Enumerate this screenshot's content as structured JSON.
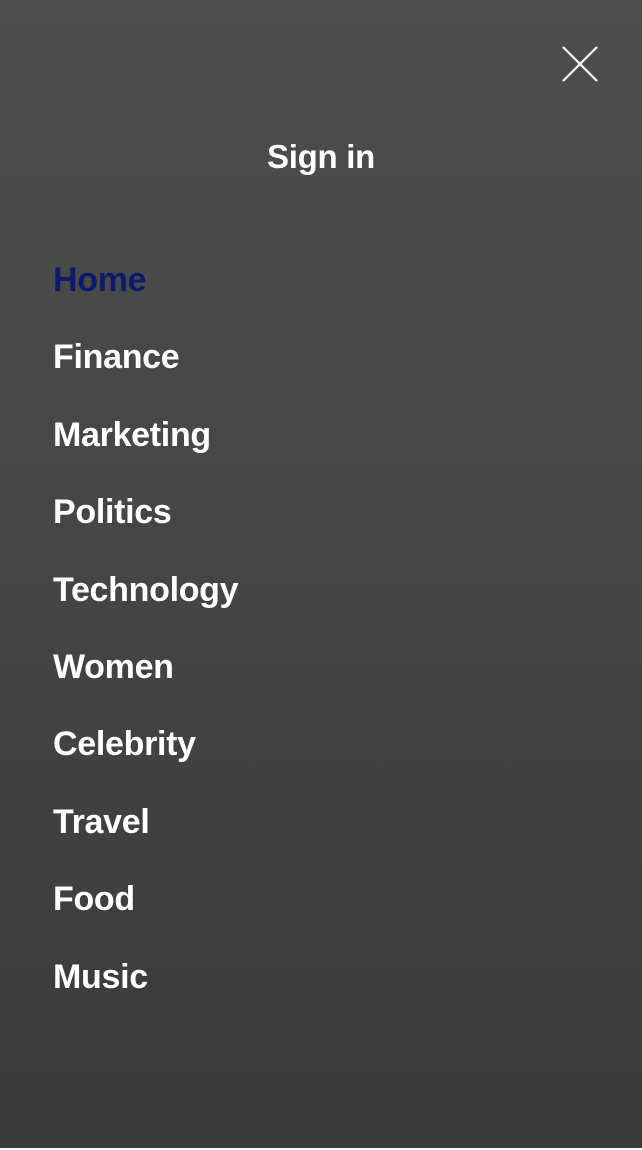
{
  "menu": {
    "close_icon": "close-icon",
    "sign_in_label": "Sign in",
    "active_color": "#0c1a6b",
    "text_color": "#ffffff",
    "background_colors": [
      "#4d4d4d",
      "#3a3a3a"
    ],
    "items": [
      {
        "label": "Home",
        "active": true
      },
      {
        "label": "Finance",
        "active": false
      },
      {
        "label": "Marketing",
        "active": false
      },
      {
        "label": "Politics",
        "active": false
      },
      {
        "label": "Technology",
        "active": false
      },
      {
        "label": "Women",
        "active": false
      },
      {
        "label": "Celebrity",
        "active": false
      },
      {
        "label": "Travel",
        "active": false
      },
      {
        "label": "Food",
        "active": false
      },
      {
        "label": "Music",
        "active": false
      }
    ]
  }
}
